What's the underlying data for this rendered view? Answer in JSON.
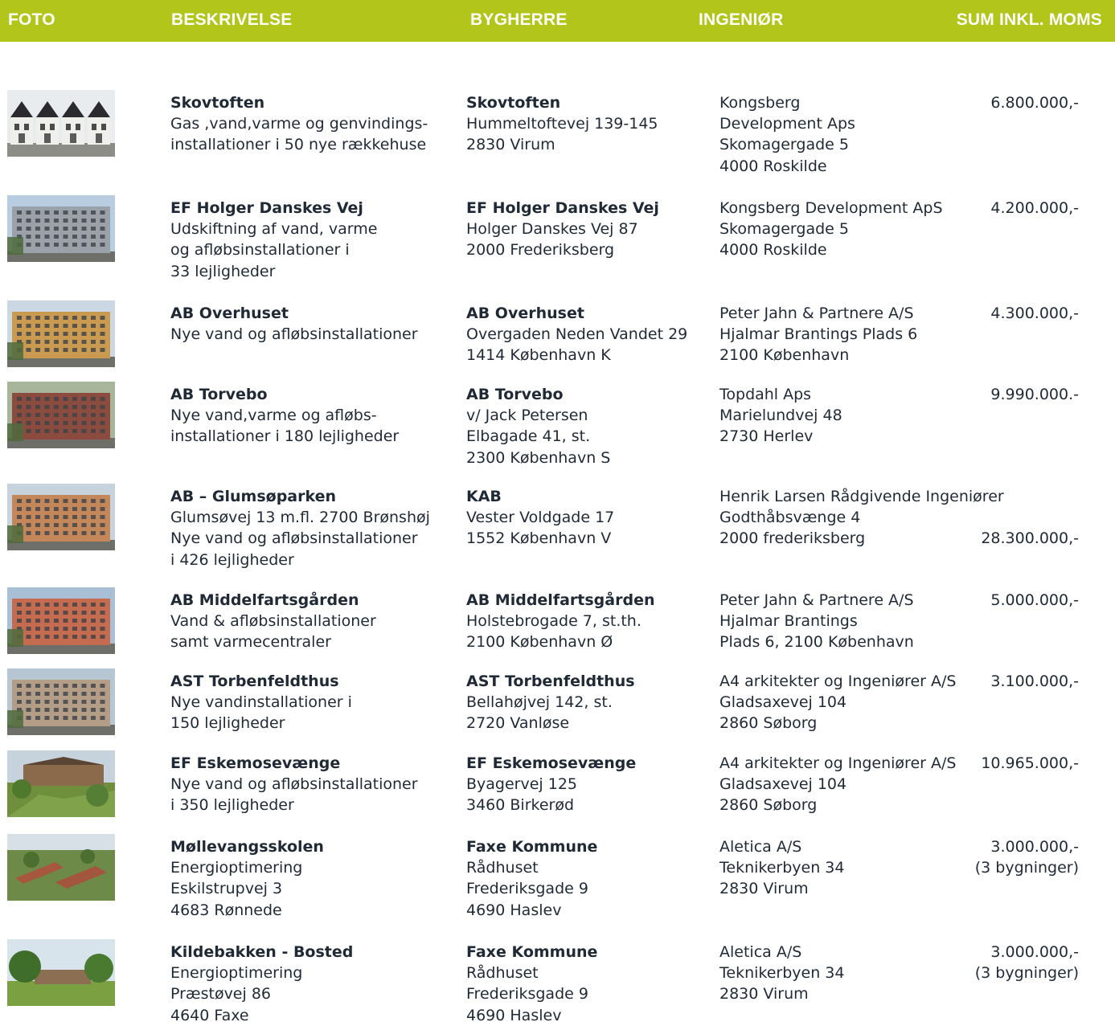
{
  "header": {
    "foto": "FOTO",
    "beskrivelse": "BESKRIVELSE",
    "bygherre": "BYGHERRE",
    "ingenior": "INGENIØR",
    "sum": "SUM INKL. MOMS"
  },
  "colors": {
    "header_bg": "#b2c51b",
    "header_text": "#ffffff",
    "body_text": "#1f2a36"
  },
  "rows": [
    {
      "photo": "row-houses-photo",
      "desc": [
        "Skovtoften",
        "Gas ,vand,varme og genvindings-",
        "installationer i 50 nye rækkehuse"
      ],
      "owner": [
        "Skovtoften",
        "Hummeltoftevej  139-145",
        "2830  Virum"
      ],
      "engineer": [
        "Kongsberg",
        "Development Aps",
        "Skomagergade  5",
        "4000  Roskilde"
      ],
      "sum": [
        "6.800.000,-"
      ]
    },
    {
      "photo": "apartment-block-photo",
      "desc": [
        "EF Holger Danskes Vej",
        "Udskiftning af vand, varme",
        "og afløbsinstallationer i",
        "33 lejligheder"
      ],
      "owner": [
        "EF Holger Danskes Vej",
        "Holger Danskes Vej  87",
        "2000  Frederiksberg"
      ],
      "engineer": [
        "Kongsberg Development ApS",
        "Skomagergade  5",
        "4000  Roskilde"
      ],
      "sum": [
        "4.200.000,-"
      ]
    },
    {
      "photo": "apartment-block-photo",
      "desc": [
        "AB Overhuset",
        "Nye vand og afløbsinstallationer"
      ],
      "owner": [
        "AB Overhuset",
        "Overgaden Neden Vandet  29",
        "1414 København K"
      ],
      "engineer": [
        "Peter Jahn & Partnere A/S",
        "Hjalmar Brantings Plads 6",
        "2100 København"
      ],
      "sum": [
        "4.300.000,-"
      ]
    },
    {
      "photo": "apartment-block-photo",
      "desc": [
        "AB Torvebo",
        "Nye vand,varme og afløbs-",
        "installationer i 180  lejligheder"
      ],
      "owner": [
        "AB Torvebo",
        "v/ Jack Petersen",
        "Elbagade  41, st.",
        "2300 København  S"
      ],
      "engineer": [
        "Topdahl Aps",
        "Marielundvej  48",
        "2730  Herlev"
      ],
      "sum": [
        "9.990.000.-"
      ]
    },
    {
      "photo": "apartment-block-photo",
      "desc": [
        "AB – Glumsøparken",
        "Glumsøvej 13 m.fl. 2700  Brønshøj",
        "Nye vand og afløbsinstallationer",
        "i 426 lejligheder"
      ],
      "owner": [
        "KAB",
        "Vester Voldgade 17",
        "1552  København  V"
      ],
      "engineer": [
        "Henrik Larsen Rådgivende Ingeniører",
        "Godthåbsvænge 4",
        "2000 frederiksberg"
      ],
      "sum": [
        "",
        "",
        "28.300.000,-"
      ]
    },
    {
      "photo": "apartment-block-photo",
      "desc": [
        "AB Middelfartsgården",
        "Vand & afløbsinstallationer",
        "samt varmecentraler"
      ],
      "owner": [
        "AB Middelfartsgården",
        "Holstebrogade 7, st.th.",
        "2100  København  Ø"
      ],
      "engineer": [
        "Peter Jahn & Partnere A/S",
        "Hjalmar Brantings",
        "Plads 6, 2100 København"
      ],
      "sum": [
        "5.000.000,-"
      ]
    },
    {
      "photo": "apartment-block-photo",
      "desc": [
        "AST Torbenfeldthus",
        "Nye vandinstallationer i",
        "150 lejligheder"
      ],
      "owner": [
        "AST Torbenfeldthus",
        "Bellahøjvej  142, st.",
        "2720  Vanløse"
      ],
      "engineer": [
        "A4 arkitekter og Ingeniører A/S",
        "Gladsaxevej  104",
        "2860  Søborg"
      ],
      "sum": [
        "3.100.000,-"
      ]
    },
    {
      "photo": "courtyard-photo",
      "desc": [
        "EF Eskemosevænge",
        "Nye vand og afløbsinstallationer",
        "i 350 lejligheder"
      ],
      "owner": [
        "EF Eskemosevænge",
        "Byagervej  125",
        "3460  Birkerød"
      ],
      "engineer": [
        "A4 arkitekter og Ingeniører A/S",
        "Gladsaxevej  104",
        "2860  Søborg"
      ],
      "sum": [
        "10.965.000,-"
      ]
    },
    {
      "photo": "aerial-school-photo",
      "desc": [
        "Møllevangsskolen",
        "Energioptimering",
        "Eskilstrupvej  3",
        "4683  Rønnede"
      ],
      "owner": [
        "Faxe Kommune",
        "Rådhuset",
        "Frederiksgade  9",
        "4690  Haslev"
      ],
      "engineer": [
        "Aletica  A/S",
        "Teknikerbyen  34",
        "2830 Virum"
      ],
      "sum": [
        "3.000.000,-",
        "(3 bygninger)"
      ]
    },
    {
      "photo": "park-building-photo",
      "desc": [
        "Kildebakken - Bosted",
        "Energioptimering",
        "Præstøvej  86",
        "4640  Faxe"
      ],
      "owner": [
        "Faxe Kommune",
        "Rådhuset",
        "Frederiksgade  9",
        "4690  Haslev"
      ],
      "engineer": [
        "Aletica  A/S",
        "Teknikerbyen  34",
        "2830  Virum"
      ],
      "sum": [
        "3.000.000,-",
        "(3 bygninger)"
      ]
    }
  ]
}
